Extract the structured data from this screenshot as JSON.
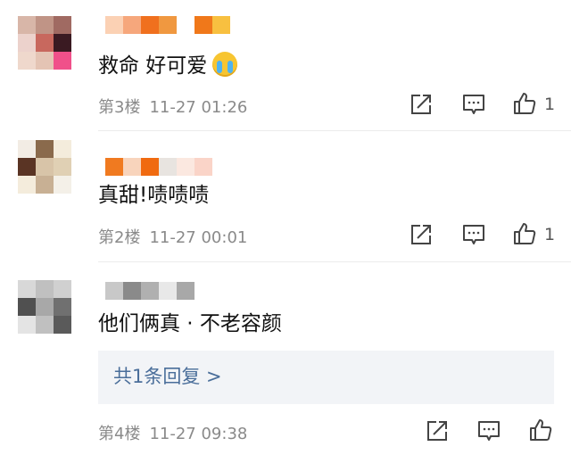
{
  "comments": [
    {
      "text": "救命 好可爱",
      "emoji_icon": "crying-face-icon",
      "floor": "第3楼",
      "time": "11-27 01:26",
      "like_count": "1",
      "avatar_colors": [
        "#d8b6a8",
        "#c09486",
        "#a06a62",
        "#ecd2cc",
        "#c8685e",
        "#3a1a22",
        "#efd8cc",
        "#e4c4b4",
        "#f0508a"
      ],
      "name_colors": [
        "#fbd1b4",
        "#f6a77c",
        "#f0701e",
        "#f09840",
        "#ffffff",
        "#f0781a",
        "#f8c040"
      ]
    },
    {
      "text": "真甜!啧啧啧",
      "floor": "第2楼",
      "time": "11-27 00:01",
      "like_count": "1",
      "avatar_colors": [
        "#f2ece4",
        "#8a6a4c",
        "#f4ecdc",
        "#5a3424",
        "#d8c4a8",
        "#e0d0b4",
        "#f4ecdc",
        "#c8b094",
        "#f4f0e8"
      ],
      "name_colors": [
        "#f07a20",
        "#f8d4bc",
        "#f06a10",
        "#e8e4e0",
        "#fbe8e0",
        "#fad4c8"
      ]
    },
    {
      "text": "他们俩真 · 不老容颜",
      "floor": "第4楼",
      "time": "11-27 09:38",
      "like_count": "",
      "reply_text": "共1条回复 >",
      "avatar_colors": [
        "#d8d8d8",
        "#c0c0c0",
        "#d0d0d0",
        "#505050",
        "#a8a8a8",
        "#707070",
        "#e4e4e4",
        "#c0c0c0",
        "#5a5a5a"
      ],
      "name_colors": [
        "#c8c8c8",
        "#8a8a8a",
        "#b0b0b0",
        "#e8e8e8",
        "#a8a8a8"
      ]
    }
  ],
  "icons": {
    "share": "share-icon",
    "reply": "comment-icon",
    "like": "thumbs-up-icon"
  },
  "colors": {
    "meta_text": "#8a8a8a",
    "reply_link": "#4a6e9a",
    "reply_bg": "#f2f4f7"
  }
}
